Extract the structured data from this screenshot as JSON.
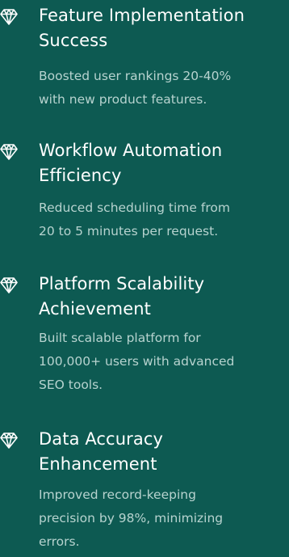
{
  "achievements": [
    {
      "title_lines": [
        "Feature Implementation",
        "Success"
      ],
      "desc_lines": [
        "Boosted user rankings 20-40%",
        "with new product features."
      ],
      "icon": "diamond-icon"
    },
    {
      "title_lines": [
        "Workflow Automation",
        "Efficiency"
      ],
      "desc_lines": [
        "Reduced scheduling time from",
        "20 to 5 minutes per request."
      ],
      "icon": "diamond-icon"
    },
    {
      "title_lines": [
        "Platform Scalability",
        "Achievement"
      ],
      "desc_lines": [
        "Built scalable platform for",
        "100,000+ users with advanced",
        "SEO tools."
      ],
      "icon": "diamond-icon"
    },
    {
      "title_lines": [
        "Data Accuracy",
        "Enhancement"
      ],
      "desc_lines": [
        "Improved record-keeping",
        "precision by 98%, minimizing",
        "errors."
      ],
      "icon": "diamond-icon"
    }
  ],
  "colors": {
    "background": "#0d5a52",
    "title": "#ffffff",
    "description": "#b7d3cf"
  }
}
